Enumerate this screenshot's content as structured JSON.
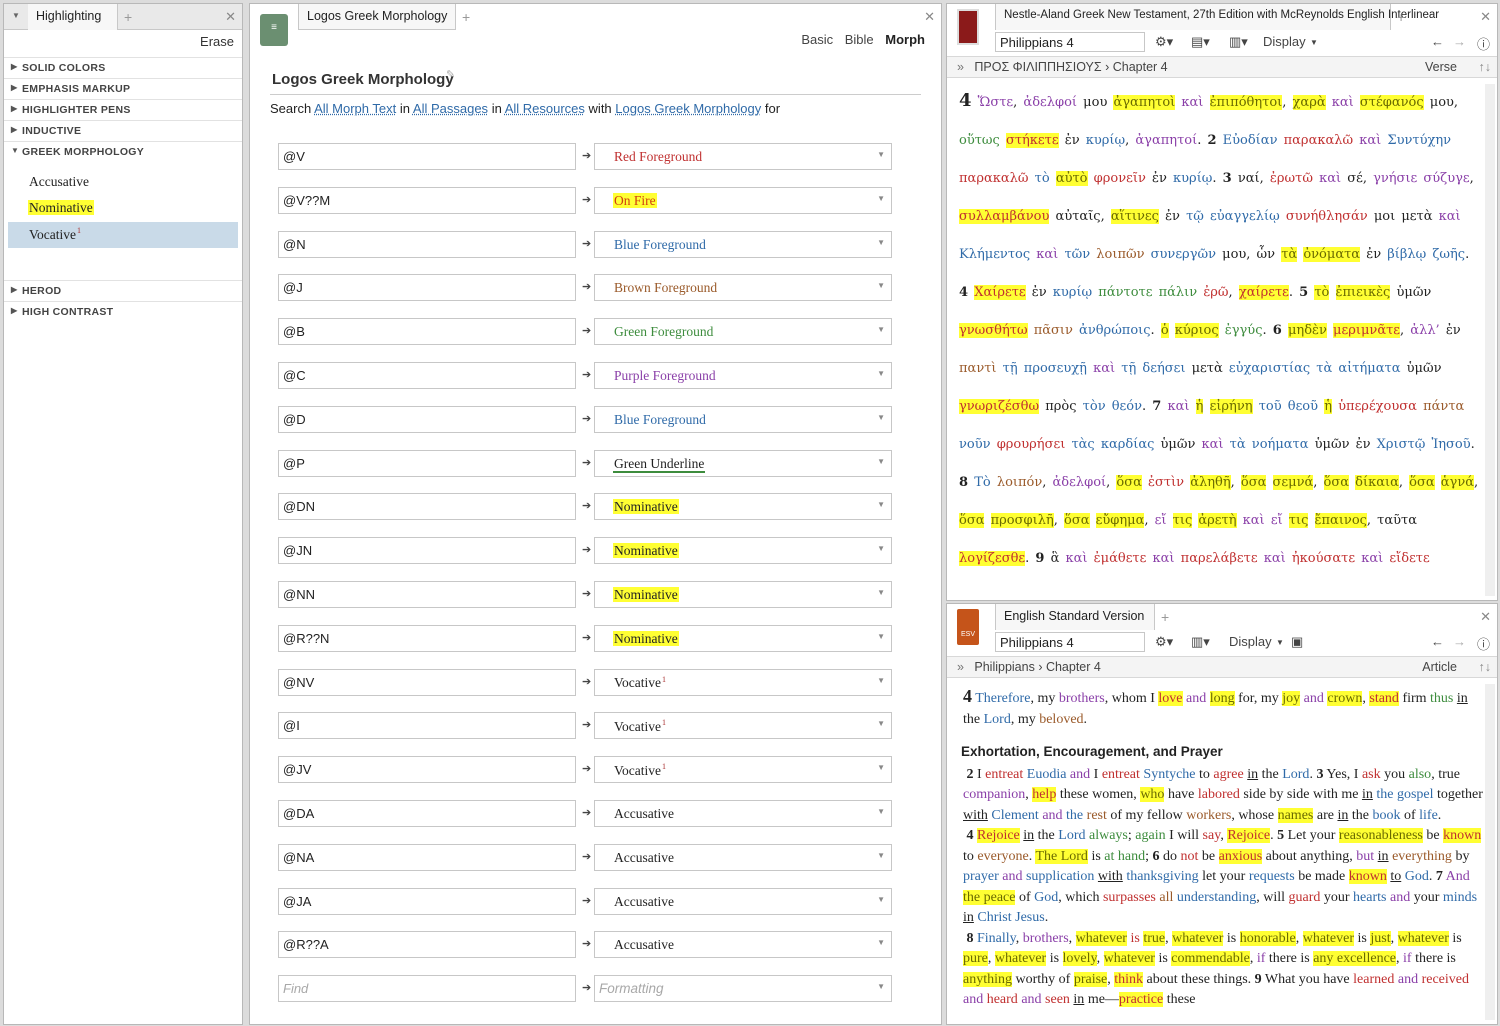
{
  "left": {
    "tab": "Highlighting",
    "erase": "Erase",
    "categories": [
      "SOLID COLORS",
      "EMPHASIS MARKUP",
      "HIGHLIGHTER PENS",
      "INDUCTIVE",
      "GREEK MORPHOLOGY"
    ],
    "styles": [
      "Accusative",
      "Nominative",
      "Vocative"
    ],
    "categories2": [
      "HEROD",
      "HIGH CONTRAST"
    ]
  },
  "mid": {
    "tab": "Logos Greek Morphology",
    "views": [
      "Basic",
      "Bible",
      "Morph"
    ],
    "title": "Logos Greek Morphology",
    "search": {
      "pre": "Search",
      "a": "All Morph Text",
      "in1": "in",
      "b": "All Passages",
      "in2": "in",
      "c": "All Resources",
      "with": "with",
      "d": "Logos Greek Morphology",
      "for": "for"
    },
    "rows": [
      {
        "q": "@V",
        "f": "Red Foreground"
      },
      {
        "q": "@V??M",
        "f": "On Fire"
      },
      {
        "q": "@N",
        "f": "Blue Foreground"
      },
      {
        "q": "@J",
        "f": "Brown Foreground"
      },
      {
        "q": "@B",
        "f": "Green Foreground"
      },
      {
        "q": "@C",
        "f": "Purple Foreground"
      },
      {
        "q": "@D",
        "f": "Blue Foreground"
      },
      {
        "q": "@P",
        "f": "Green Underline"
      },
      {
        "q": "@DN",
        "f": "Nominative"
      },
      {
        "q": "@JN",
        "f": "Nominative"
      },
      {
        "q": "@NN",
        "f": "Nominative"
      },
      {
        "q": "@R??N",
        "f": "Nominative"
      },
      {
        "q": "@NV",
        "f": "Vocative"
      },
      {
        "q": "@I",
        "f": "Vocative"
      },
      {
        "q": "@JV",
        "f": "Vocative"
      },
      {
        "q": "@DA",
        "f": "Accusative"
      },
      {
        "q": "@NA",
        "f": "Accusative"
      },
      {
        "q": "@JA",
        "f": "Accusative"
      },
      {
        "q": "@R??A",
        "f": "Accusative"
      }
    ],
    "find_ph": "Find",
    "format_ph": "Formatting"
  },
  "na27": {
    "tab": "Nestle-Aland Greek New Testament, 27th Edition with McReynolds English Interlinear",
    "ref": "Philippians 4",
    "display": "Display",
    "nav_book": "ΠΡΟΣ ΦΙΛΙΠΠΗΣΙΟΥΣ",
    "nav_ch": "Chapter 4",
    "verse": "Verse"
  },
  "esv": {
    "tab": "English Standard Version",
    "ref": "Philippians 4",
    "display": "Display",
    "nav_book": "Philippians",
    "nav_ch": "Chapter 4",
    "article": "Article",
    "heading": "Exhortation, Encouragement, and Prayer"
  }
}
